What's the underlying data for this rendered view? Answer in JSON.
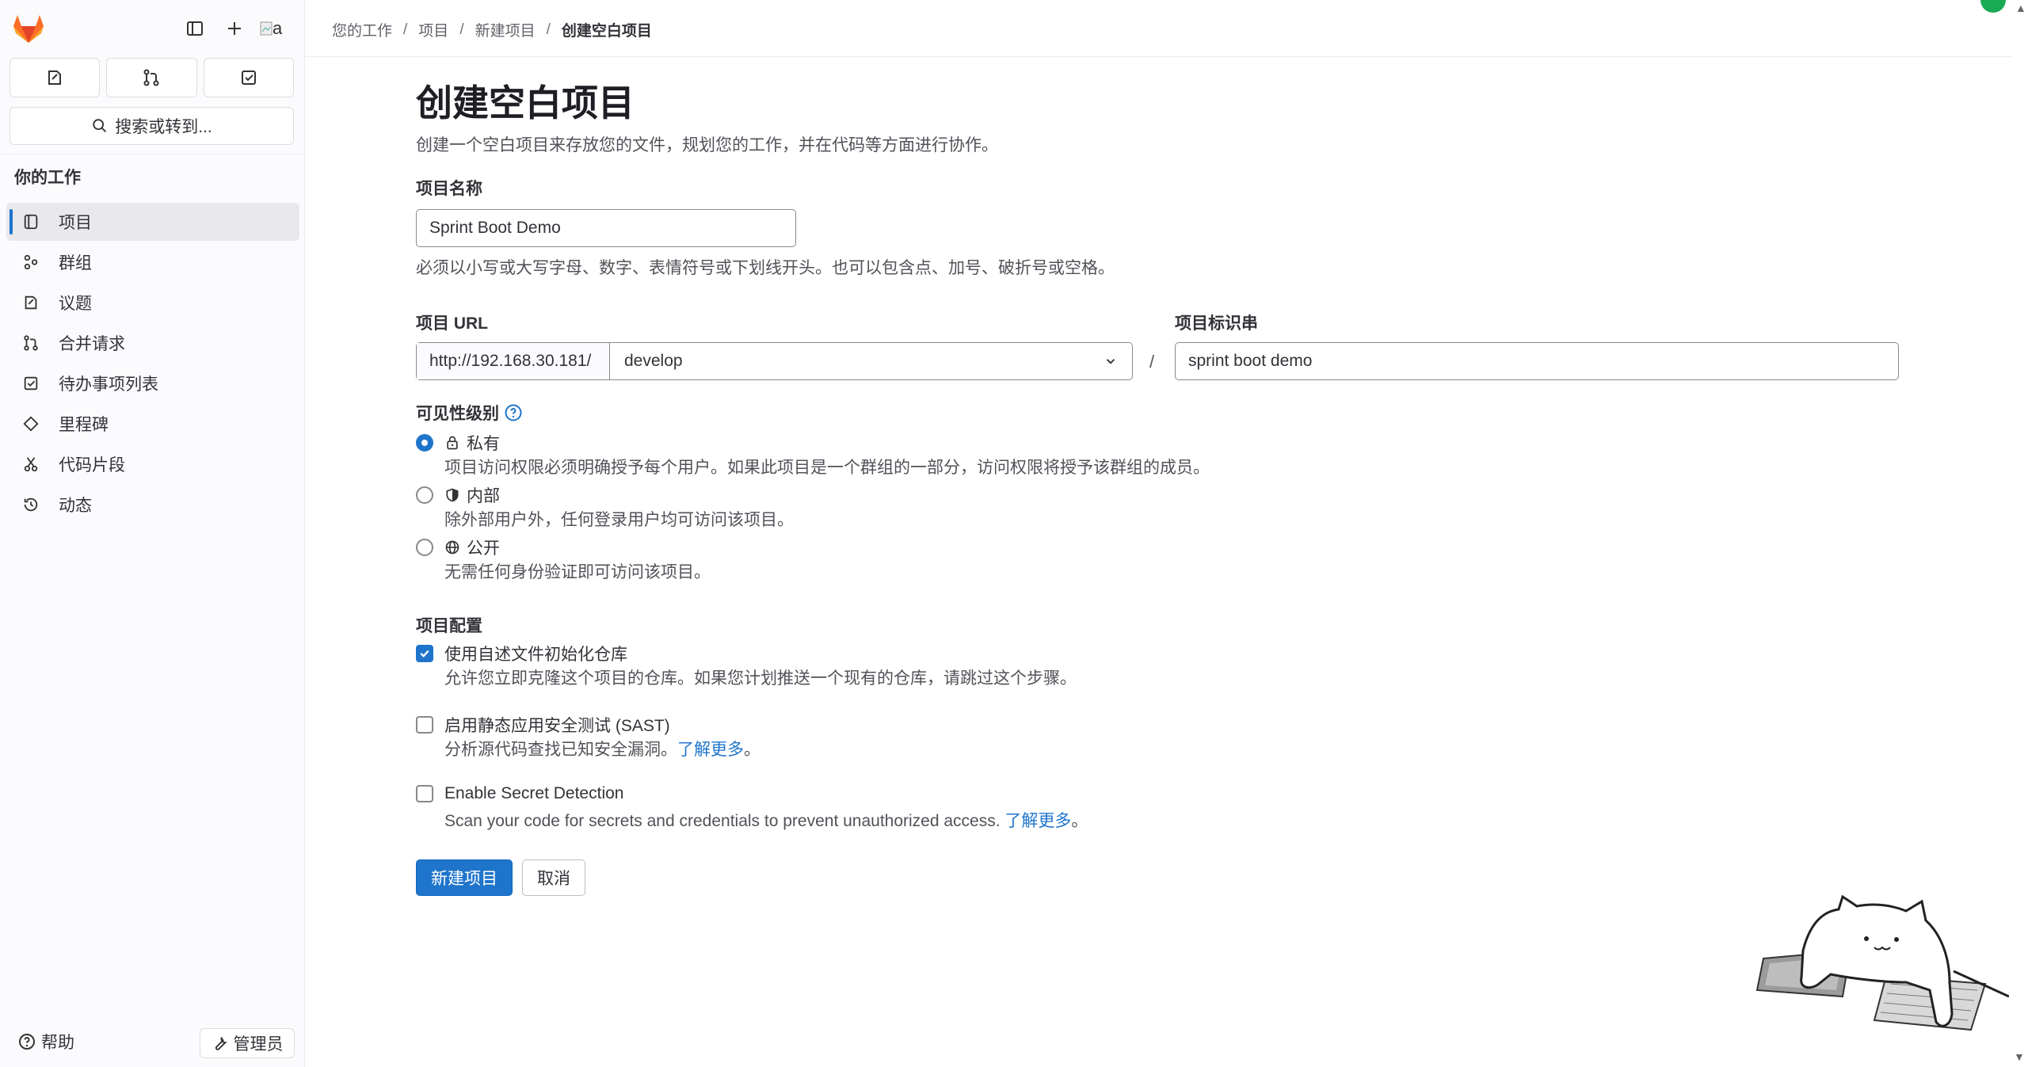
{
  "sidebar": {
    "search_label": "搜索或转到...",
    "avatar_alt": "a",
    "section_title": "你的工作",
    "items": [
      {
        "label": "项目",
        "icon": "project-icon",
        "active": true
      },
      {
        "label": "群组",
        "icon": "group-icon",
        "active": false
      },
      {
        "label": "议题",
        "icon": "issues-icon",
        "active": false
      },
      {
        "label": "合并请求",
        "icon": "merge-request-icon",
        "active": false
      },
      {
        "label": "待办事项列表",
        "icon": "todo-icon",
        "active": false
      },
      {
        "label": "里程碑",
        "icon": "milestone-icon",
        "active": false
      },
      {
        "label": "代码片段",
        "icon": "snippet-icon",
        "active": false
      },
      {
        "label": "动态",
        "icon": "history-icon",
        "active": false
      }
    ],
    "help_label": "帮助",
    "admin_label": "管理员"
  },
  "breadcrumb": [
    "您的工作",
    "项目",
    "新建项目",
    "创建空白项目"
  ],
  "page": {
    "title": "创建空白项目",
    "description": "创建一个空白项目来存放您的文件，规划您的工作，并在代码等方面进行协作。"
  },
  "form": {
    "project_name_label": "项目名称",
    "project_name_value": "Sprint Boot Demo",
    "project_name_help": "必须以小写或大写字母、数字、表情符号或下划线开头。也可以包含点、加号、破折号或空格。",
    "project_url_label": "项目 URL",
    "project_url_prefix": "http://192.168.30.181/",
    "namespace_value": "develop",
    "slash": "/",
    "project_slug_label": "项目标识串",
    "project_slug_value": "sprint boot demo",
    "visibility_label": "可见性级别",
    "visibility": [
      {
        "label": "私有",
        "icon": "lock-icon",
        "desc": "项目访问权限必须明确授予每个用户。如果此项目是一个群组的一部分，访问权限将授予该群组的成员。",
        "checked": true
      },
      {
        "label": "内部",
        "icon": "shield-icon",
        "desc": "除外部用户外，任何登录用户均可访问该项目。",
        "checked": false
      },
      {
        "label": "公开",
        "icon": "globe-icon",
        "desc": "无需任何身份验证即可访问该项目。",
        "checked": false
      }
    ],
    "config_label": "项目配置",
    "config": [
      {
        "label": "使用自述文件初始化仓库",
        "desc": "允许您立即克隆这个项目的仓库。如果您计划推送一个现有的仓库，请跳过这个步骤。",
        "link": "",
        "checked": true
      },
      {
        "label": "启用静态应用安全测试 (SAST)",
        "desc": "分析源代码查找已知安全漏洞。",
        "link": "了解更多",
        "suffix": "。",
        "checked": false
      },
      {
        "label": "Enable Secret Detection",
        "desc": "Scan your code for secrets and credentials to prevent unauthorized access.",
        "link": "了解更多",
        "suffix": "。",
        "checked": false
      }
    ],
    "submit_label": "新建项目",
    "cancel_label": "取消"
  },
  "colors": {
    "accent": "#1f75cb",
    "sidebar_bg": "#fbfafd",
    "logo_orange": "#fc6d26"
  }
}
